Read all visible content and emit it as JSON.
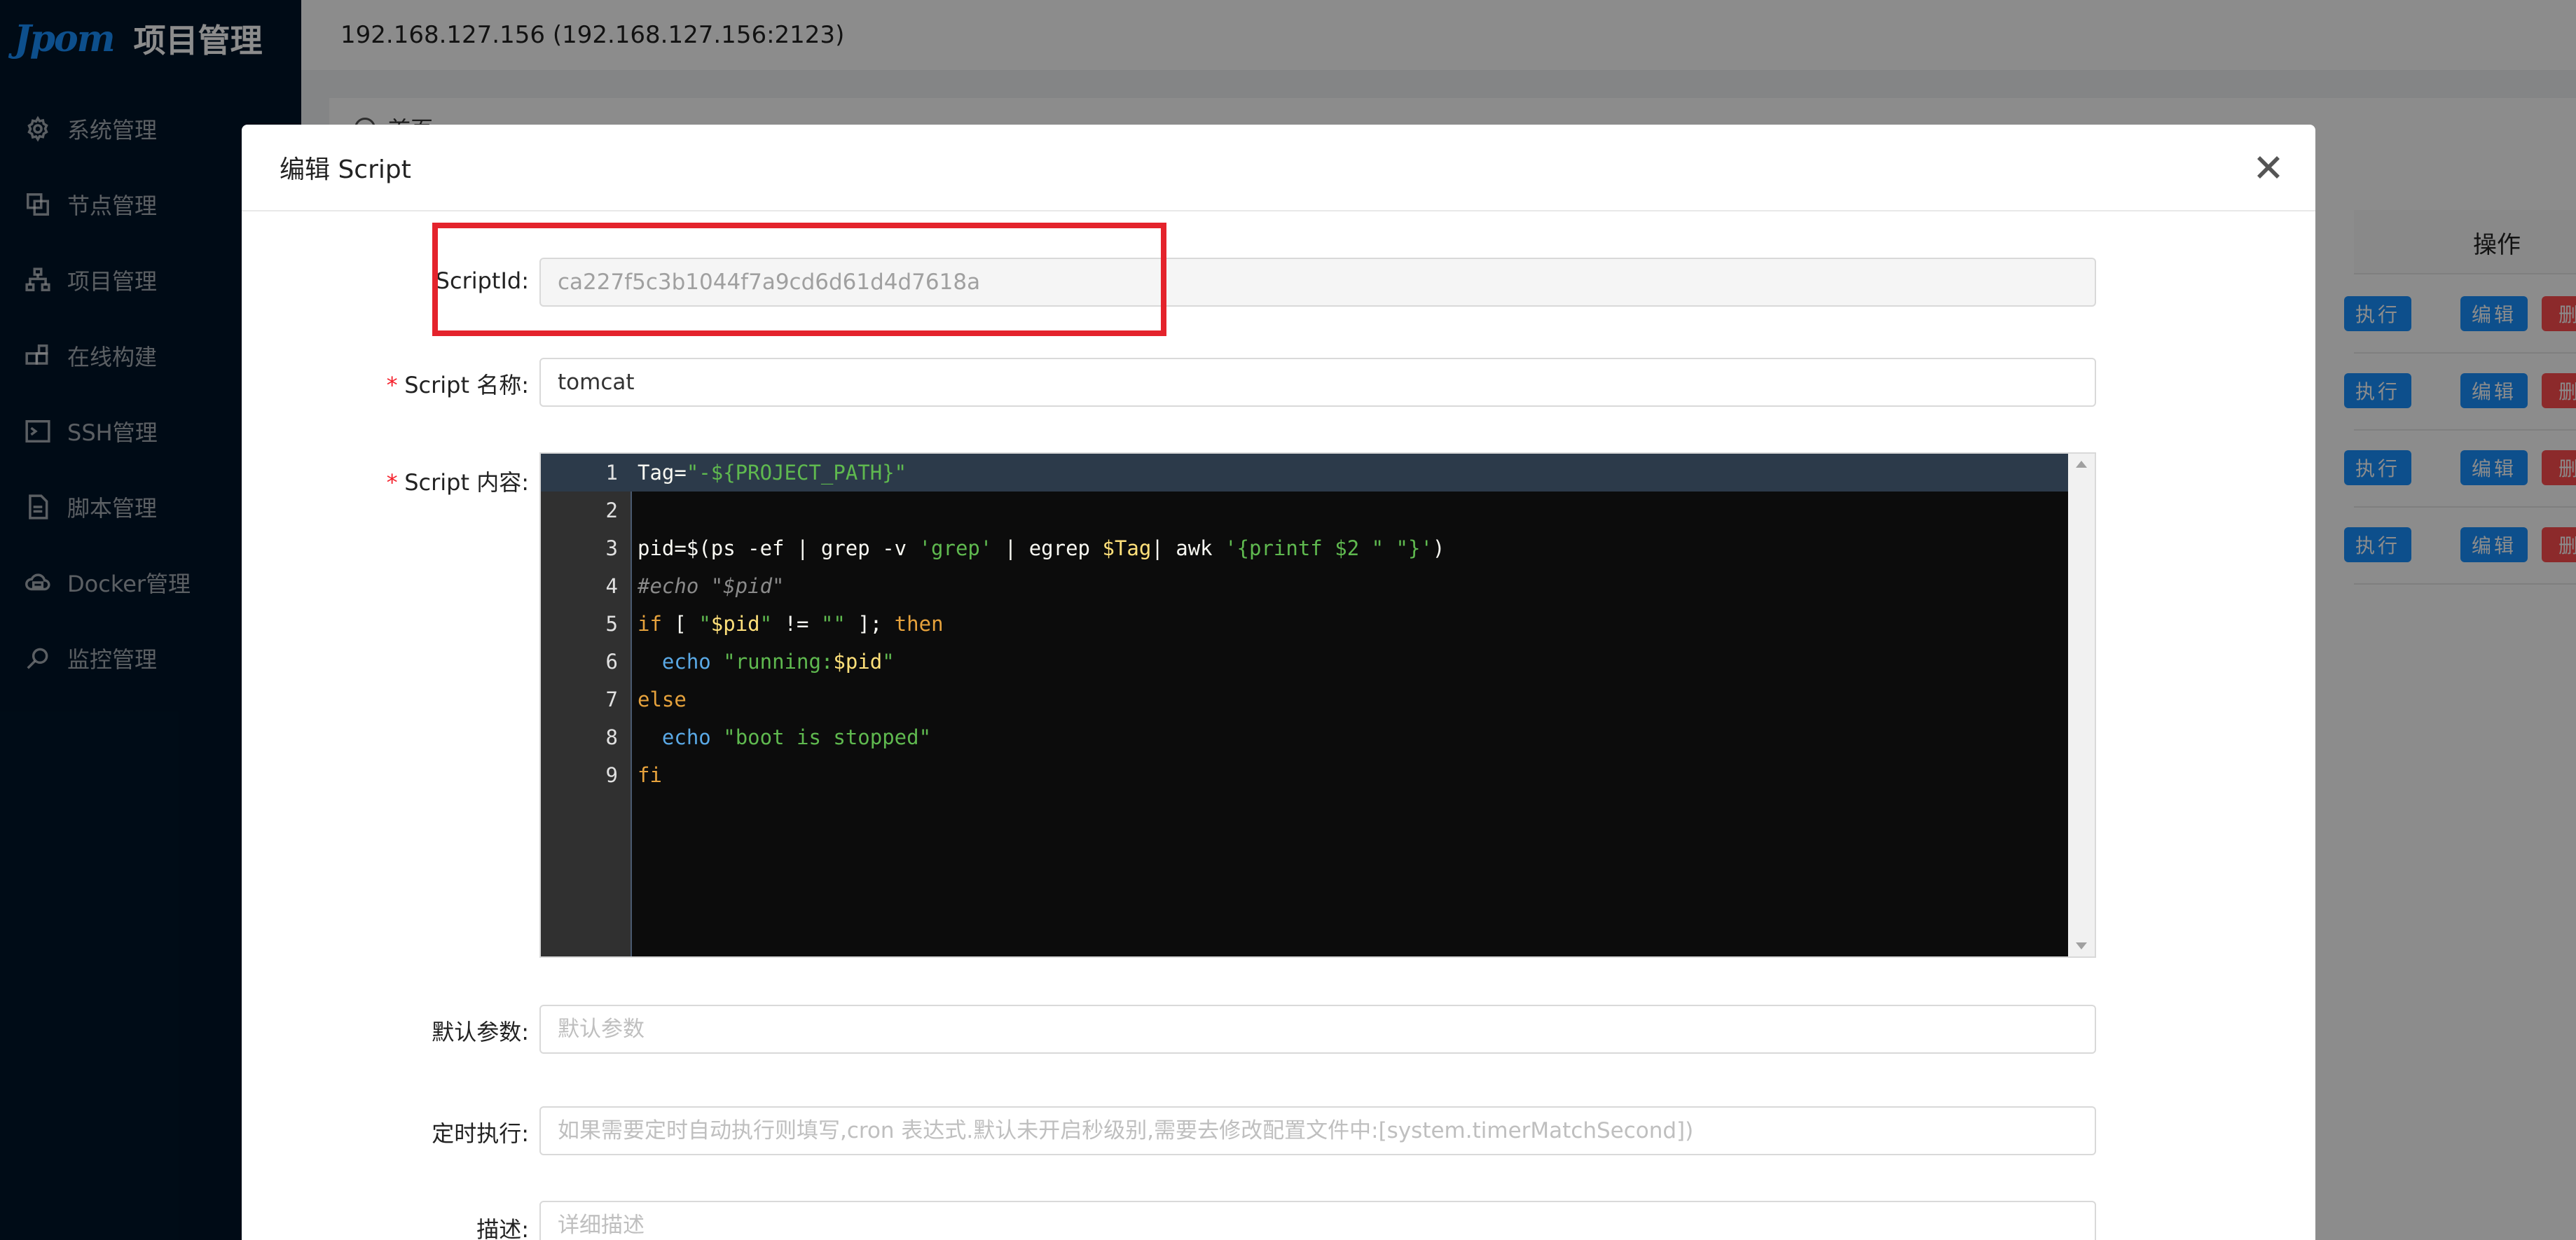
{
  "app": {
    "brand": "Jpom",
    "title": "项目管理"
  },
  "sidebar": {
    "items": [
      {
        "label": "系统管理",
        "icon": "gear-icon"
      },
      {
        "label": "节点管理",
        "icon": "copy-icon"
      },
      {
        "label": "项目管理",
        "icon": "cluster-icon"
      },
      {
        "label": "在线构建",
        "icon": "blocks-icon"
      },
      {
        "label": "SSH管理",
        "icon": "terminal-icon"
      },
      {
        "label": "脚本管理",
        "icon": "file-icon"
      },
      {
        "label": "Docker管理",
        "icon": "cloud-icon"
      },
      {
        "label": "监控管理",
        "icon": "search-icon"
      }
    ]
  },
  "topbar": {
    "node_address": "192.168.127.156 (192.168.127.156:2123)"
  },
  "inner_sider": {
    "home_label": "首页"
  },
  "table": {
    "operation_header": "操作",
    "row_actions": {
      "execute": "执行",
      "edit": "编辑",
      "delete": "删"
    },
    "row_count": 4
  },
  "modal": {
    "title": "编辑 Script",
    "fields": {
      "script_id": {
        "label": "ScriptId",
        "value": "ca227f5c3b1044f7a9cd6d61d4d7618a"
      },
      "script_name": {
        "label": "Script 名称",
        "value": "tomcat"
      },
      "script_content": {
        "label": "Script 内容"
      },
      "default_args": {
        "label": "默认参数",
        "placeholder": "默认参数"
      },
      "cron": {
        "label": "定时执行",
        "placeholder": "如果需要定时自动执行则填写,cron 表达式.默认未开启秒级别,需要去修改配置文件中:[system.timerMatchSecond])"
      },
      "description": {
        "label": "描述",
        "placeholder": "详细描述"
      }
    },
    "label_suffix": ":",
    "required_mark": "*"
  },
  "code": {
    "lines": [
      {
        "n": "1",
        "t": "Tag=\"-${PROJECT_PATH}\""
      },
      {
        "n": "2",
        "t": ""
      },
      {
        "n": "3",
        "t": "pid=$(ps -ef | grep -v 'grep' | egrep $Tag| awk '{printf $2 \" \"}')"
      },
      {
        "n": "4",
        "t": "#echo \"$pid\""
      },
      {
        "n": "5",
        "t": "if [ \"$pid\" != \"\" ]; then"
      },
      {
        "n": "6",
        "t": "  echo \"running:$pid\""
      },
      {
        "n": "7",
        "t": "else"
      },
      {
        "n": "8",
        "t": "  echo \"boot is stopped\""
      },
      {
        "n": "9",
        "t": "fi"
      }
    ]
  },
  "colors": {
    "sider_bg": "#001529",
    "primary": "#1890ff",
    "danger": "#ff4d4f",
    "highlight": "#e4232c",
    "editor_bg": "#0c0c0c"
  }
}
